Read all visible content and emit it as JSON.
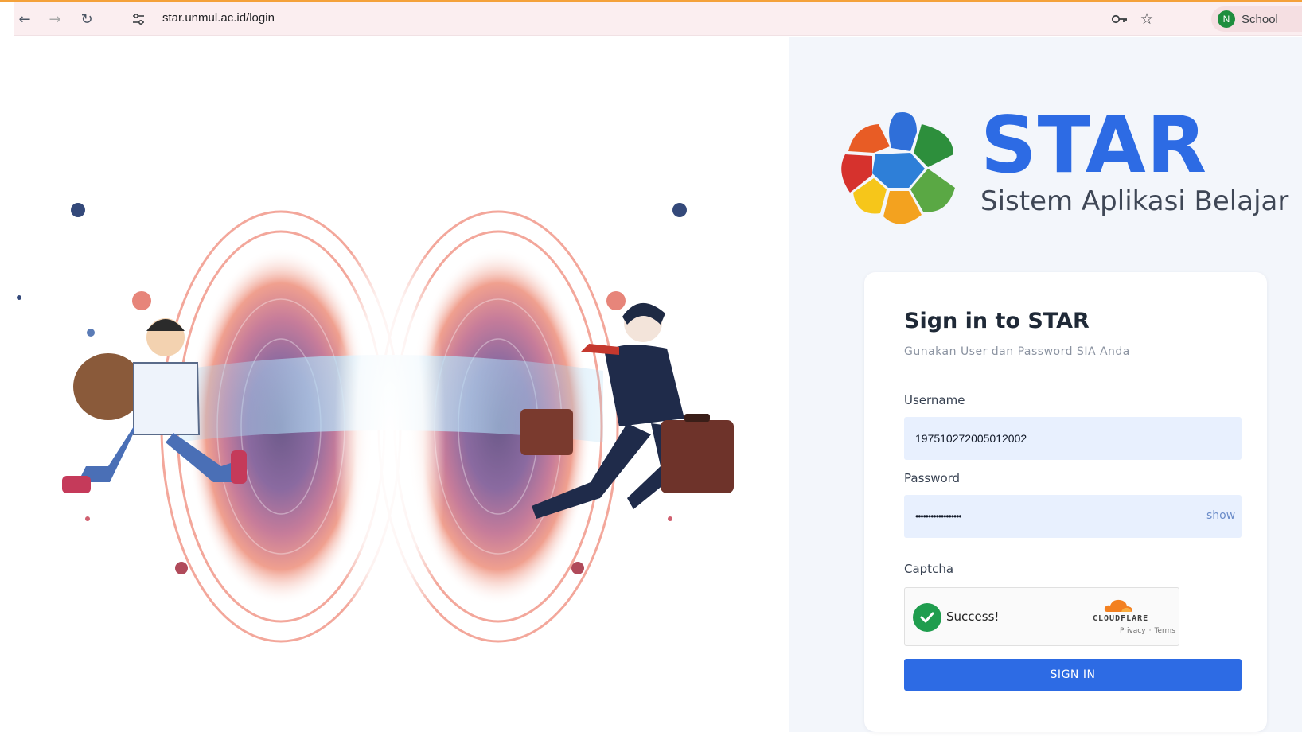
{
  "browser": {
    "url": "star.unmul.ac.id/login",
    "profile_initial": "N",
    "profile_name": "School"
  },
  "logo": {
    "title": "STAR",
    "subtitle": "Sistem Aplikasi Belajar"
  },
  "login": {
    "title": "Sign in to STAR",
    "subtitle": "Gunakan User dan Password SIA Anda",
    "username_label": "Username",
    "username_value": "197510272005012002",
    "password_label": "Password",
    "password_mask": "••••••••••••••••••",
    "show_label": "show",
    "captcha_label": "Captcha",
    "captcha_status": "Success!",
    "captcha_brand": "CLOUDFLARE",
    "captcha_privacy": "Privacy",
    "captcha_separator": "·",
    "captcha_terms": "Terms",
    "submit_label": "SIGN IN"
  },
  "colors": {
    "accent": "#2d6be4",
    "input_bg": "#e8f0fe",
    "success": "#1f9d4e",
    "cloudflare": "#f38020"
  }
}
